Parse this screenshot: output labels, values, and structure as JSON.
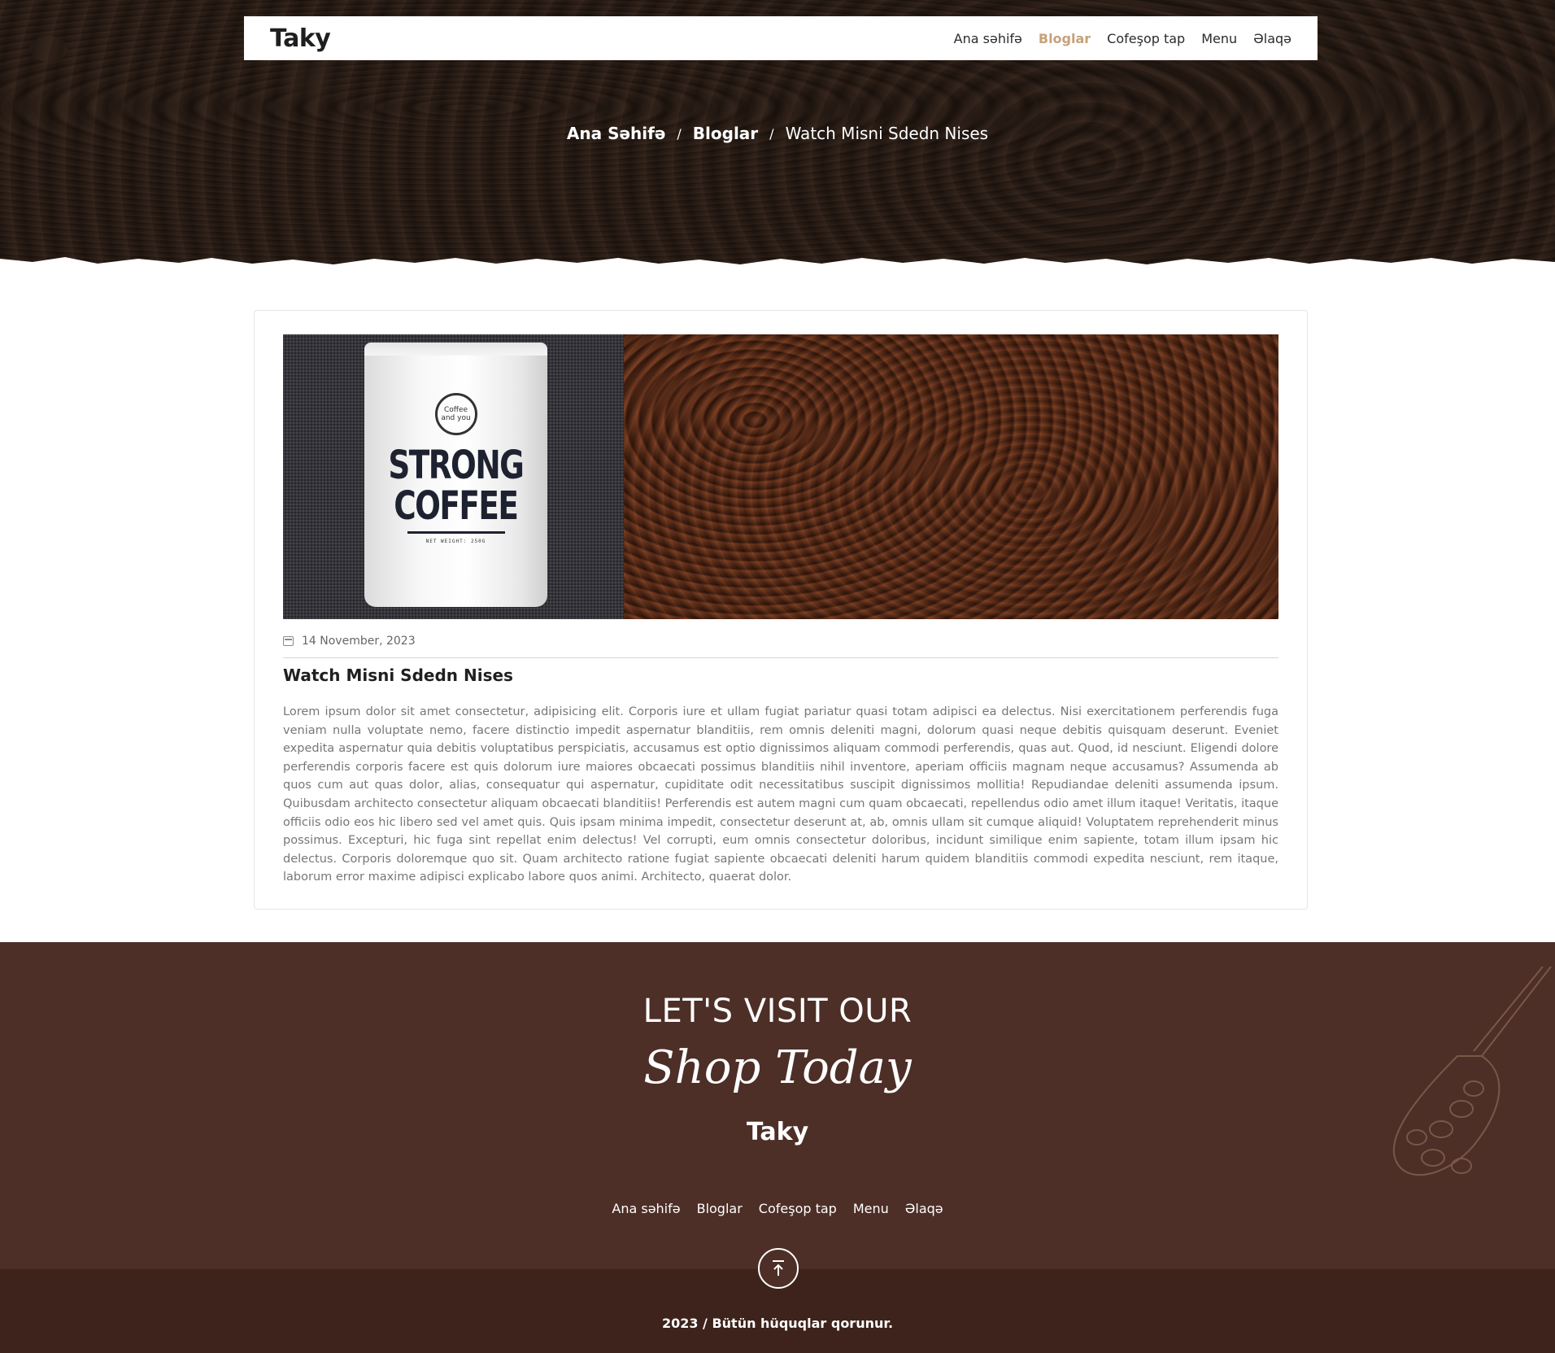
{
  "header": {
    "logo": "Taky",
    "nav": [
      {
        "label": "Ana səhifə",
        "active": false
      },
      {
        "label": "Bloglar",
        "active": true
      },
      {
        "label": "Cofeşop tap",
        "active": false
      },
      {
        "label": "Menu",
        "active": false
      },
      {
        "label": "Əlaqə",
        "active": false
      }
    ]
  },
  "breadcrumb": {
    "home": "Ana Səhifə",
    "section": "Bloglar",
    "current": "Watch Misni Sdedn Nises",
    "separator": "/"
  },
  "post": {
    "image": {
      "bag_badge": "Coffee and you",
      "bag_title_line1": "STRONG",
      "bag_title_line2": "COFFEE",
      "bag_small": "NET WEIGHT: 250G"
    },
    "date": "14 November, 2023",
    "date_icon": "calendar-icon",
    "title": "Watch Misni Sdedn Nises",
    "body": "Lorem ipsum dolor sit amet consectetur, adipisicing elit. Corporis iure et ullam fugiat pariatur quasi totam adipisci ea delectus. Nisi exercitationem perferendis fuga veniam nulla voluptate nemo, facere distinctio impedit aspernatur blanditiis, rem omnis deleniti magni, dolorum quasi neque debitis quisquam deserunt. Eveniet expedita aspernatur quia debitis voluptatibus perspiciatis, accusamus est optio dignissimos aliquam commodi perferendis, quas aut. Quod, id nesciunt. Eligendi dolore perferendis corporis facere est quis dolorum iure maiores obcaecati possimus blanditiis nihil inventore, aperiam officiis magnam neque accusamus? Assumenda ab quos cum aut quas dolor, alias, consequatur qui aspernatur, cupiditate odit necessitatibus suscipit dignissimos mollitia! Repudiandae deleniti assumenda ipsum. Quibusdam architecto consectetur aliquam obcaecati blanditiis! Perferendis est autem magni cum quam obcaecati, repellendus odio amet illum itaque! Veritatis, itaque officiis odio eos hic libero sed vel amet quis. Quis ipsam minima impedit, consectetur deserunt at, ab, omnis ullam sit cumque aliquid! Voluptatem reprehenderit minus possimus. Excepturi, hic fuga sint repellat enim delectus! Vel corrupti, eum omnis consectetur doloribus, incidunt similique enim sapiente, totam illum ipsam hic delectus. Corporis doloremque quo sit. Quam architecto ratione fugiat sapiente obcaecati deleniti harum quidem blanditiis commodi expedita nesciunt, rem itaque, laborum error maxime adipisci explicabo labore quos animi. Architecto, quaerat dolor."
  },
  "footer": {
    "heading": "LET'S VISIT OUR",
    "script": "Shop Today",
    "logo": "Taky",
    "nav": [
      "Ana səhifə",
      "Bloglar",
      "Cofeşop tap",
      "Menu",
      "Əlaqə"
    ],
    "copyright": "2023 / Bütün hüquqlar qorunur.",
    "back_to_top_icon": "arrow-up-to-top-icon"
  },
  "colors": {
    "accent": "#c7a17a",
    "footer_bg": "#4d2f27",
    "bottom_bar_bg": "#3d231b"
  }
}
